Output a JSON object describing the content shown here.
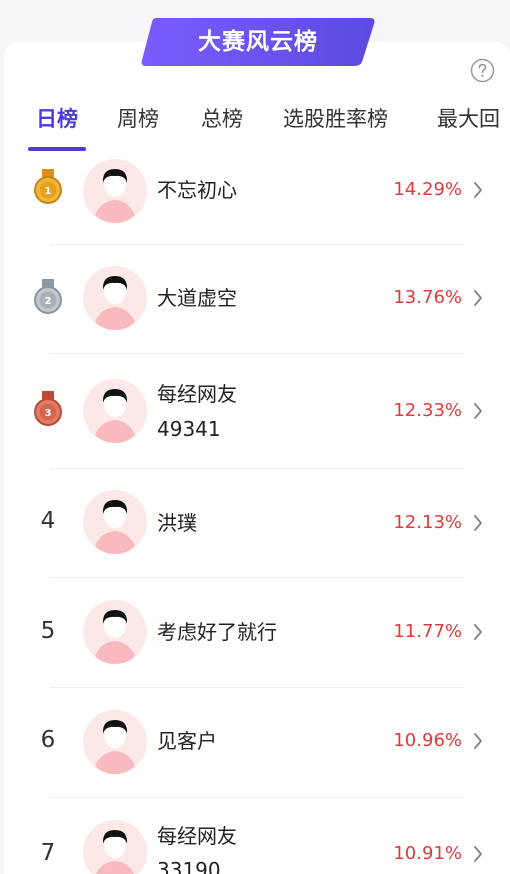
{
  "header": {
    "title": "大赛风云榜",
    "help_icon": "question-circle-icon"
  },
  "colors": {
    "accent": "#4b3fd6",
    "banner_start": "#7b5cff",
    "banner_end": "#5b4bdd",
    "rate": "#e03a3a",
    "gold": "#e4a21e",
    "silver": "#a9b0b8",
    "bronze": "#d4664f",
    "avatar_bg": "#fde8e8"
  },
  "tabs": [
    {
      "label": "日榜",
      "active": true
    },
    {
      "label": "周榜",
      "active": false
    },
    {
      "label": "总榜",
      "active": false
    },
    {
      "label": "选股胜率榜",
      "active": false
    },
    {
      "label": "最大回",
      "active": false
    }
  ],
  "rows": [
    {
      "rank": "1",
      "medal": "gold",
      "name_lines": [
        "不忘初心"
      ],
      "rate": "14.29%"
    },
    {
      "rank": "2",
      "medal": "silver",
      "name_lines": [
        "大道虚空"
      ],
      "rate": "13.76%"
    },
    {
      "rank": "3",
      "medal": "bronze",
      "name_lines": [
        "每经网友",
        "49341"
      ],
      "rate": "12.33%"
    },
    {
      "rank": "4",
      "medal": null,
      "name_lines": [
        "洪璞"
      ],
      "rate": "12.13%"
    },
    {
      "rank": "5",
      "medal": null,
      "name_lines": [
        "考虑好了就行"
      ],
      "rate": "11.77%"
    },
    {
      "rank": "6",
      "medal": null,
      "name_lines": [
        "见客户"
      ],
      "rate": "10.96%"
    },
    {
      "rank": "7",
      "medal": null,
      "name_lines": [
        "每经网友",
        "33190"
      ],
      "rate": "10.91%"
    }
  ]
}
